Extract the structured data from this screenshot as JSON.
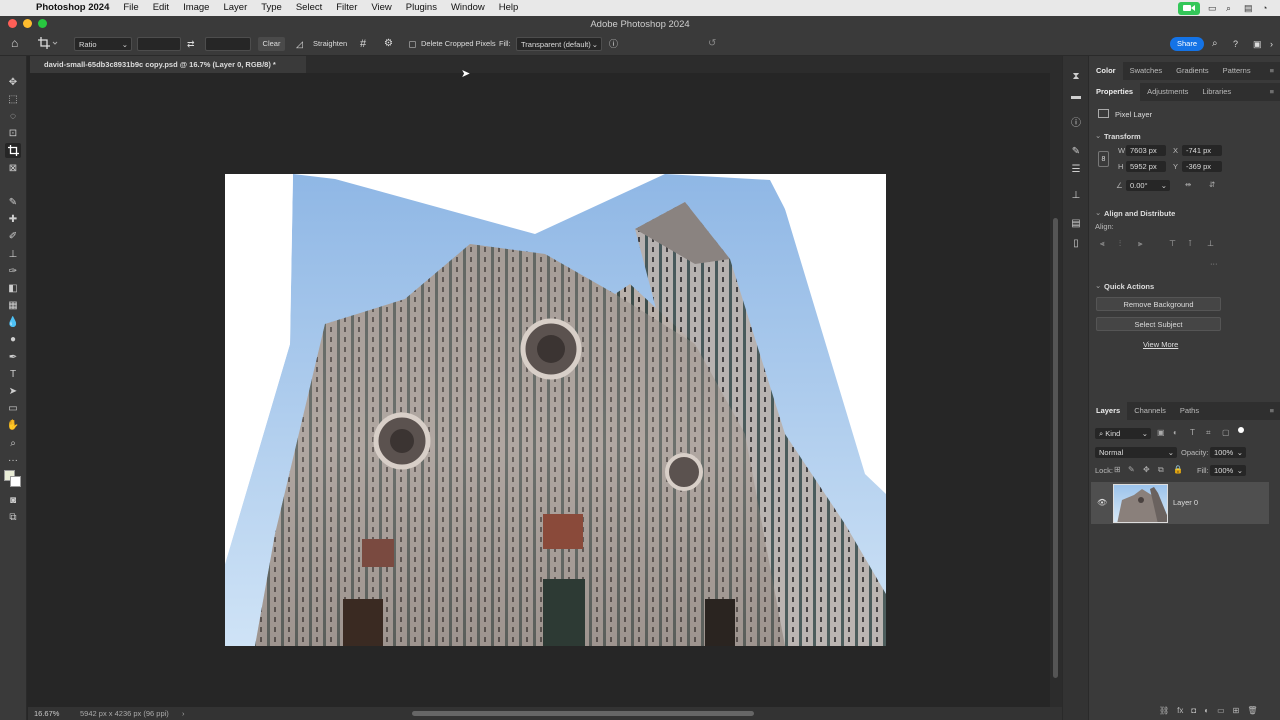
{
  "menubar": {
    "app_name": "Photoshop 2024",
    "items": [
      "File",
      "Edit",
      "Image",
      "Layer",
      "Type",
      "Select",
      "Filter",
      "View",
      "Plugins",
      "Window",
      "Help"
    ]
  },
  "window": {
    "title": "Adobe Photoshop 2024"
  },
  "options_bar": {
    "ratio_value": "Ratio",
    "clear_label": "Clear",
    "straighten_label": "Straighten",
    "delete_cropped_label": "Delete Cropped Pixels",
    "fill_label": "Fill:",
    "fill_value": "Transparent (default)",
    "share_label": "Share"
  },
  "document": {
    "tab_title": "david-small-65db3c8931b9c copy.psd @ 16.7% (Layer 0, RGB/8) *"
  },
  "status": {
    "zoom": "16.67%",
    "doc_info": "5942 px x 4236 px (96 ppi)"
  },
  "panels": {
    "top_tabs": [
      "Color",
      "Swatches",
      "Gradients",
      "Patterns"
    ],
    "prop_tabs": [
      "Properties",
      "Adjustments",
      "Libraries"
    ],
    "pixel_layer_label": "Pixel Layer",
    "transform": {
      "title": "Transform",
      "w_label": "W",
      "w_value": "7603 px",
      "h_label": "H",
      "h_value": "5952 px",
      "x_label": "X",
      "x_value": "-741 px",
      "y_label": "Y",
      "y_value": "-369 px",
      "angle_value": "0.00°"
    },
    "align": {
      "title": "Align and Distribute",
      "align_label": "Align:"
    },
    "quick_actions": {
      "title": "Quick Actions",
      "remove_bg": "Remove Background",
      "select_subject": "Select Subject",
      "view_more": "View More"
    },
    "layers_tabs": [
      "Layers",
      "Channels",
      "Paths"
    ],
    "layers": {
      "kind_label": "Kind",
      "blend_mode": "Normal",
      "opacity_label": "Opacity:",
      "opacity_value": "100%",
      "lock_label": "Lock:",
      "fill_label": "Fill:",
      "fill_value": "100%",
      "layer_name": "Layer 0"
    }
  },
  "colors": {
    "ps_bg": "#262626",
    "panel_bg": "#3a3a3a",
    "accent_blue": "#1473e6",
    "facetime_green": "#34c759"
  }
}
